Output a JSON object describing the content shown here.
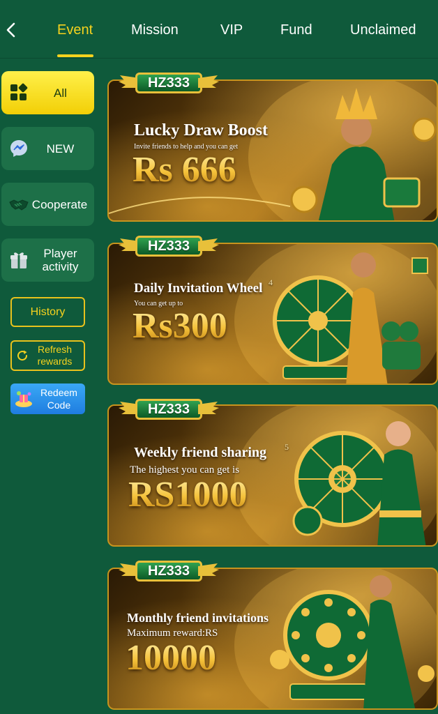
{
  "tabs": [
    {
      "label": "Event",
      "active": true
    },
    {
      "label": "Mission",
      "active": false
    },
    {
      "label": "VIP",
      "active": false
    },
    {
      "label": "Fund",
      "active": false
    },
    {
      "label": "Unclaimed",
      "active": false
    }
  ],
  "back_icon": "chevron-left-icon",
  "sidebar": {
    "categories": [
      {
        "label": "All",
        "icon": "grid-icon",
        "active": true
      },
      {
        "label": "NEW",
        "icon": "messenger-icon",
        "active": false
      },
      {
        "label": "Cooperate",
        "icon": "handshake-icon",
        "active": false
      },
      {
        "label": "Player activity",
        "icon": "gift-box-icon",
        "active": false
      }
    ],
    "history_label": "History",
    "refresh_label": "Refresh rewards",
    "redeem_label": "Redeem Code"
  },
  "banners": [
    {
      "logo": "HZ333",
      "title": "Lucky Draw Boost",
      "subtitle": "Invite friends to help and you can get",
      "amount": "Rs 666"
    },
    {
      "logo": "HZ333",
      "title": "Daily Invitation Wheel",
      "badge": "4",
      "subtitle": "You can get up to",
      "amount": "Rs300"
    },
    {
      "logo": "HZ333",
      "title": "Weekly friend sharing",
      "badge": "5",
      "subtitle": "The highest you can get is",
      "amount": "RS1000"
    },
    {
      "logo": "HZ333",
      "title": "Monthly friend invitations",
      "subtitle": "Maximum reward:RS",
      "amount": "10000"
    }
  ],
  "colors": {
    "background": "#0f5a3b",
    "accent": "#f6d21e",
    "sidebar_button": "#1d7048",
    "gold": "#e8c03a"
  }
}
